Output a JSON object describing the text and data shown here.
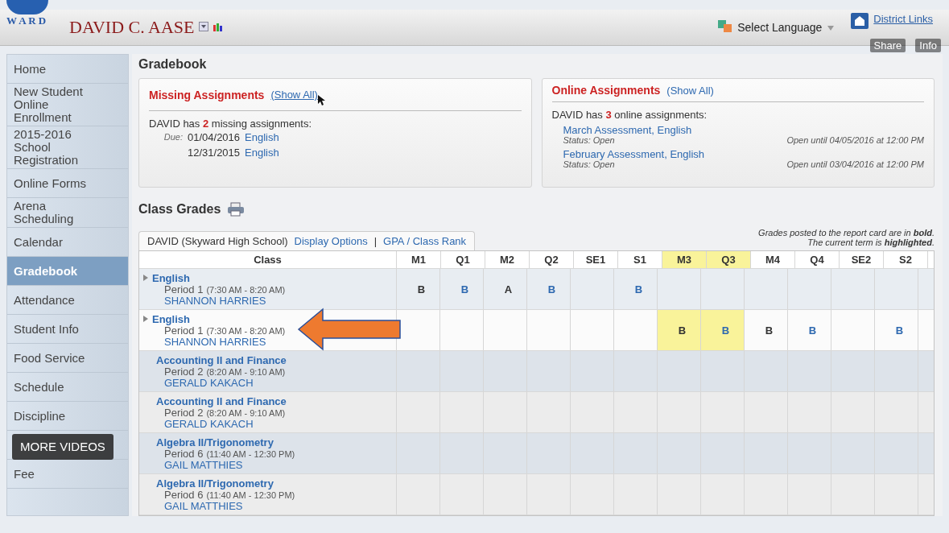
{
  "header": {
    "logo_letters": "W A R D",
    "user_name": "DAVID C. AASE",
    "language": "Select Language",
    "district_links": "District Links"
  },
  "video_overlay": {
    "share": "Share",
    "info": "Info",
    "more_videos": "MORE VIDEOS"
  },
  "sidebar": {
    "items": [
      {
        "label": "Home",
        "selected": false
      },
      {
        "label": "New Student Online Enrollment",
        "selected": false
      },
      {
        "label": "2015-2016 School Registration",
        "selected": false
      },
      {
        "label": "Online Forms",
        "selected": false
      },
      {
        "label": "Arena Scheduling",
        "selected": false
      },
      {
        "label": "Calendar",
        "selected": false
      },
      {
        "label": "Gradebook",
        "selected": true
      },
      {
        "label": "Attendance",
        "selected": false
      },
      {
        "label": "Student Info",
        "selected": false
      },
      {
        "label": "Food Service",
        "selected": false
      },
      {
        "label": "Schedule",
        "selected": false
      },
      {
        "label": "Discipline",
        "selected": false
      },
      {
        "label": "Fee",
        "selected": false
      }
    ]
  },
  "page_title": "Gradebook",
  "missing": {
    "title": "Missing Assignments",
    "show_all": "(Show All)",
    "summary": "DAVID has **2** missing assignments:",
    "due_label": "Due:",
    "items": [
      {
        "date": "01/04/2016",
        "course": "English"
      },
      {
        "date": "12/31/2015",
        "course": "English"
      }
    ]
  },
  "online": {
    "title": "Online Assignments",
    "show_all": "(Show All)",
    "summary": "DAVID has **3** online assignments:",
    "items": [
      {
        "name": "March Assessment, English",
        "status": "Status: Open",
        "open_until": "Open until 04/05/2016 at 12:00 PM"
      },
      {
        "name": "February Assessment, English",
        "status": "Status: Open",
        "open_until": "Open until 03/04/2016 at 12:00 PM"
      }
    ]
  },
  "class_grades": {
    "title": "Class Grades",
    "tab": "DAVID (Skyward High School)",
    "links": [
      "Display Options",
      "GPA / Class Rank"
    ],
    "separator": "|",
    "legend": [
      "Grades posted to the report card are in **bold**.",
      "The current term is **highlighted**."
    ],
    "class_header": "Class",
    "columns": [
      {
        "label": "M1",
        "highlighted": false
      },
      {
        "label": "Q1",
        "highlighted": false
      },
      {
        "label": "M2",
        "highlighted": false
      },
      {
        "label": "Q2",
        "highlighted": false
      },
      {
        "label": "SE1",
        "highlighted": false
      },
      {
        "label": "S1",
        "highlighted": false
      },
      {
        "label": "M3",
        "highlighted": true
      },
      {
        "label": "Q3",
        "highlighted": true
      },
      {
        "label": "M4",
        "highlighted": false
      },
      {
        "label": "Q4",
        "highlighted": false
      },
      {
        "label": "SE2",
        "highlighted": false
      },
      {
        "label": "S2",
        "highlighted": false
      }
    ],
    "rows": [
      {
        "course": "English",
        "period": "Period 1",
        "time": "(7:30 AM - 8:20 AM)",
        "teacher": "SHANNON HARRIES",
        "expandable": true,
        "grades": [
          {
            "kind": "grade",
            "text": "B",
            "link": false
          },
          {
            "kind": "grade",
            "text": "B",
            "link": true
          },
          {
            "kind": "grade",
            "text": "A",
            "link": false
          },
          {
            "kind": "grade",
            "text": "B",
            "link": true
          },
          {
            "kind": "blank"
          },
          {
            "kind": "grade",
            "text": "B",
            "link": true
          },
          {
            "kind": "blank"
          },
          {
            "kind": "blank"
          },
          {
            "kind": "blank"
          },
          {
            "kind": "blank"
          },
          {
            "kind": "blank"
          },
          {
            "kind": "blank"
          }
        ]
      },
      {
        "course": "English",
        "period": "Period 1",
        "time": "(7:30 AM - 8:20 AM)",
        "teacher": "SHANNON HARRIES",
        "expandable": true,
        "grades": [
          {
            "kind": "blank"
          },
          {
            "kind": "blank"
          },
          {
            "kind": "blank"
          },
          {
            "kind": "blank"
          },
          {
            "kind": "blank"
          },
          {
            "kind": "blank"
          },
          {
            "kind": "grade",
            "text": "B",
            "link": false
          },
          {
            "kind": "grade",
            "text": "B",
            "link": true
          },
          {
            "kind": "grade",
            "text": "B",
            "link": false
          },
          {
            "kind": "grade",
            "text": "B",
            "link": true
          },
          {
            "kind": "blank"
          },
          {
            "kind": "grade",
            "text": "B",
            "link": true
          }
        ]
      },
      {
        "course": "Accounting II and Finance",
        "period": "Period 2",
        "time": "(8:20 AM - 9:10 AM)",
        "teacher": "GERALD KAKACH",
        "expandable": false
      },
      {
        "course": "Accounting II and Finance",
        "period": "Period 2",
        "time": "(8:20 AM - 9:10 AM)",
        "teacher": "GERALD KAKACH",
        "expandable": false
      },
      {
        "course": "Algebra II/Trigonometry",
        "period": "Period 6",
        "time": "(11:40 AM - 12:30 PM)",
        "teacher": "GAIL MATTHIES",
        "expandable": false
      },
      {
        "course": "Algebra II/Trigonometry",
        "period": "Period 6",
        "time": "(11:40 AM - 12:30 PM)",
        "teacher": "GAIL MATTHIES",
        "expandable": false
      }
    ]
  }
}
